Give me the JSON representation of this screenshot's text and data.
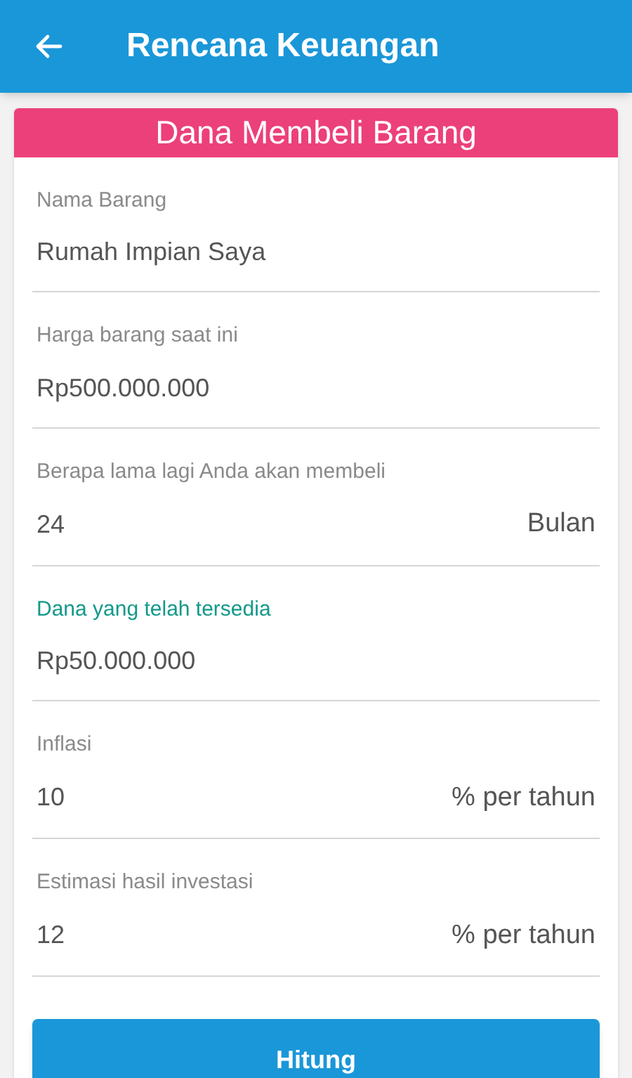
{
  "app_bar": {
    "title": "Rencana Keuangan"
  },
  "card": {
    "title": "Dana Membeli Barang",
    "fields": [
      {
        "label": "Nama Barang",
        "value": "Rumah Impian Saya",
        "focused": false
      },
      {
        "label": "Harga barang saat ini",
        "value": "Rp500.000.000",
        "focused": false
      },
      {
        "label": "Berapa lama lagi Anda akan membeli",
        "value": "24",
        "suffix": "Bulan",
        "focused": false
      },
      {
        "label": "Dana yang telah tersedia",
        "value": "Rp50.000.000",
        "focused": true
      },
      {
        "label": "Inflasi",
        "value": "10",
        "suffix": "% per tahun",
        "focused": false
      },
      {
        "label": "Estimasi hasil investasi",
        "value": "12",
        "suffix": "% per tahun",
        "focused": false
      }
    ],
    "button": "Hitung"
  }
}
